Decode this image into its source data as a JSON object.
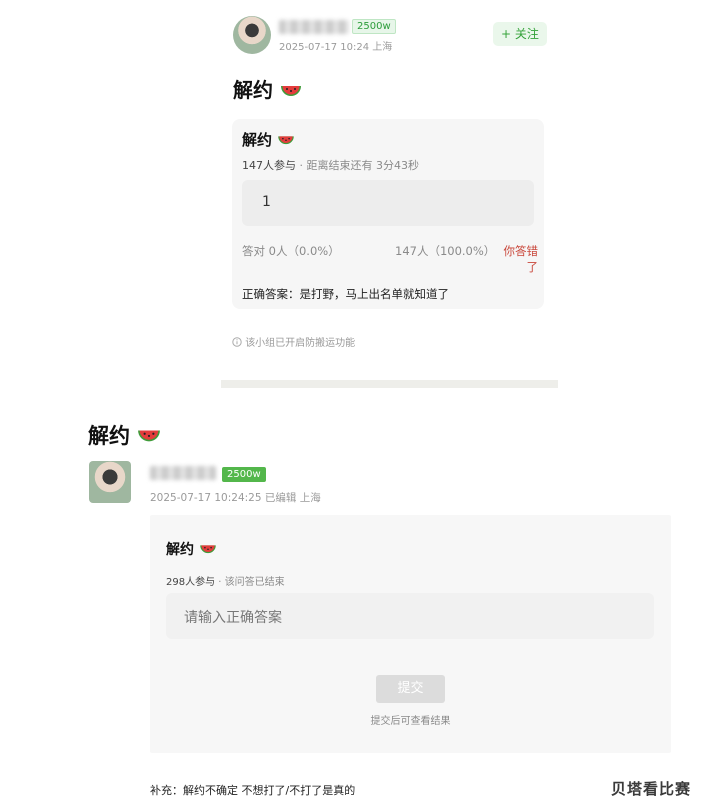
{
  "top_post": {
    "author": {
      "name": "",
      "level_badge": "2500w"
    },
    "time_location": "2025-07-17 10:24 上海",
    "follow_label": "+ 关注",
    "title": "解约",
    "poll": {
      "title": "解约",
      "stats": "147人参与",
      "remaining": "· 距离结束还有 3分43秒",
      "answer_value": "1",
      "correct_stats": "答对 0人（0.0%）",
      "wrong_stats": "147人（100.0%）",
      "wrong_tag": "你答错了",
      "correct_answer": "正确答案：是打野，马上出名单就知道了"
    },
    "notice": "该小组已开启防搬运功能"
  },
  "bottom_post": {
    "title": "解约",
    "author": {
      "name": "",
      "level_badge": "2500w"
    },
    "time_location": "2025-07-17 10:24:25 已编辑 上海",
    "poll": {
      "title": "解约",
      "stats": "298人参与",
      "status": "· 该问答已结束",
      "input_placeholder": "请输入正确答案",
      "submit_label": "提交",
      "submit_hint": "提交后可查看结果"
    },
    "supplement": "补充：解约不确定 不想打了/不打了是真的"
  },
  "watermark": "贝塔看比赛",
  "colors": {
    "accent_green": "#35a33a",
    "wrong_red": "#c9473b",
    "badge_green": "#53b74b"
  },
  "icons": [
    "watermelon-icon",
    "info-circle-icon",
    "avatar-image"
  ]
}
